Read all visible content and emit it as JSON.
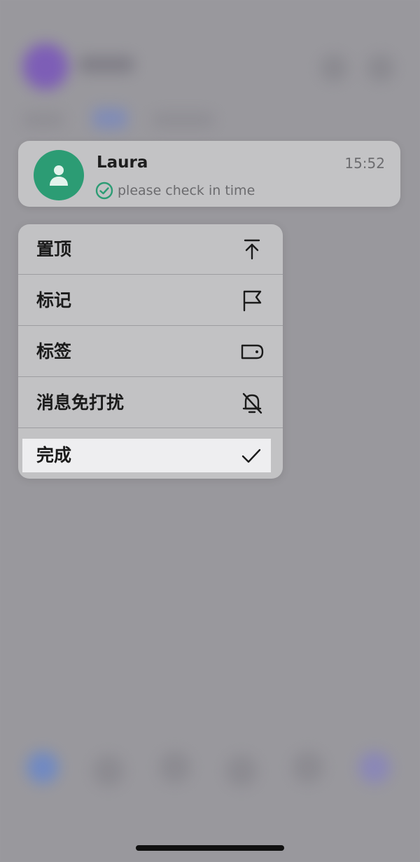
{
  "contact": {
    "name": "Laura",
    "time": "15:52",
    "preview": "please check in time",
    "avatar_color": "#2c9c74",
    "status_icon": "check-circle-icon"
  },
  "menu": {
    "items": [
      {
        "label": "置顶",
        "icon": "pin-to-top-icon"
      },
      {
        "label": "标记",
        "icon": "flag-icon"
      },
      {
        "label": "标签",
        "icon": "tag-icon"
      },
      {
        "label": "消息免打扰",
        "icon": "bell-off-icon"
      },
      {
        "label": "完成",
        "icon": "checkmark-icon",
        "highlighted": true
      }
    ]
  },
  "colors": {
    "accent": "#2c9c74",
    "overlay": "#99989d",
    "card": "#c3c3c5",
    "highlight": "#eeeef0"
  }
}
